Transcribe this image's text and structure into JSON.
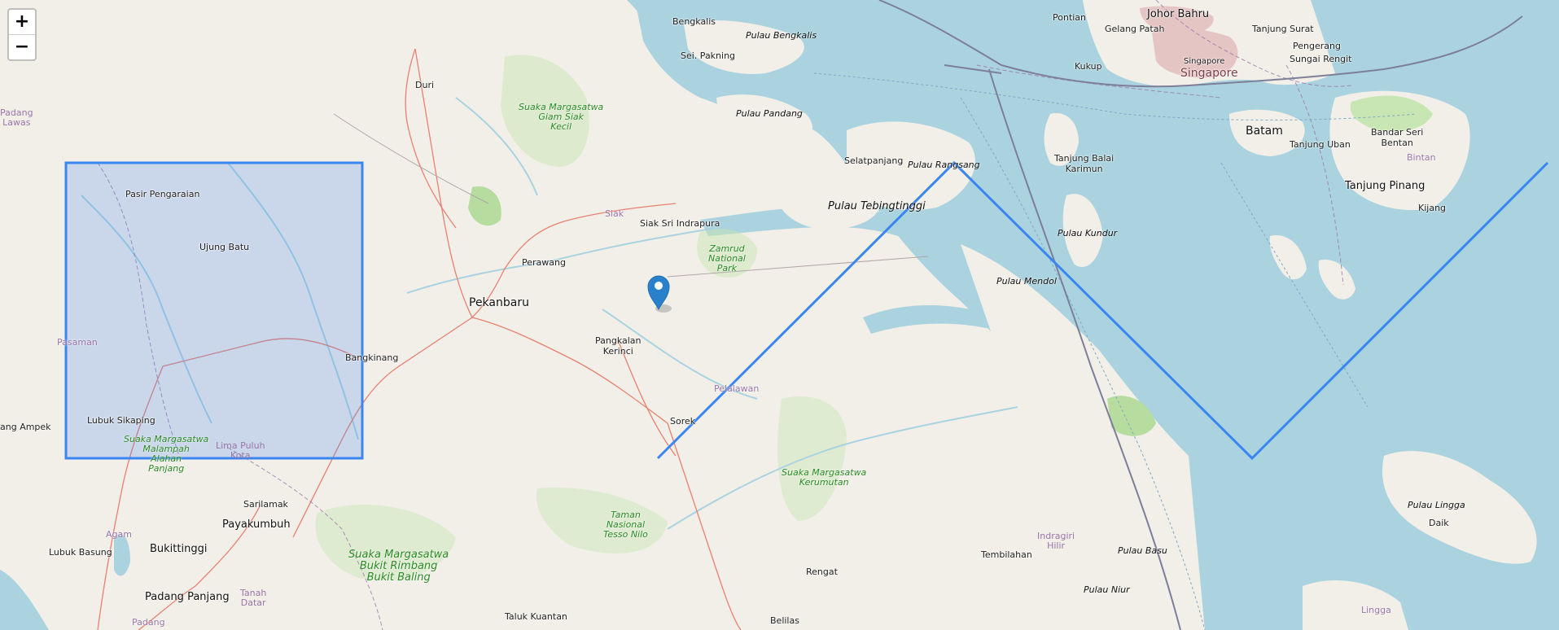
{
  "controls": {
    "zoom_in": "+",
    "zoom_out": "−"
  },
  "places": {
    "bengkalis": "Bengkalis",
    "pulau_bengkalis": "Pulau Bengkalis",
    "sei_pakning": "Sei. Pakning",
    "duri": "Duri",
    "pulau_pandang": "Pulau Pandang",
    "selatpanjang": "Selatpanjang",
    "pulau_rangsang": "Pulau Rangsang",
    "pulau_tebingtinggi": "Pulau Tebingtinggi",
    "siak": "Siak",
    "siak_sri_indrapura": "Siak Sri Indrapura",
    "perawang": "Perawang",
    "pekanbaru": "Pekanbaru",
    "pasir_pengaraian": "Pasir Pengaraian",
    "ujung_batu": "Ujung Batu",
    "bangkinang": "Bangkinang",
    "pasaman": "Pasaman",
    "padang_lawas": "Padang\nLawas",
    "lubuk_sikaping": "Lubuk Sikaping",
    "pangkalan_kerinci": "Pangkalan\nKerinci",
    "pelalawan": "Pelalawan",
    "sorek": "Sorek",
    "pulau_mendol": "Pulau Mendol",
    "pulau_kundur": "Pulau Kundur",
    "tanjung_balai_karimun": "Tanjung Balai\nKarimun",
    "pontian": "Pontian",
    "gelang_patah": "Gelang Patah",
    "johor_bahru": "Johor Bahru",
    "tanjung_surat": "Tanjung Surat",
    "pengerang": "Pengerang",
    "sungai_rengit": "Sungai Rengit",
    "kukup": "Kukup",
    "singapore_small": "Singapore",
    "singapore": "Singapore",
    "batam": "Batam",
    "tanjung_uban": "Tanjung Uban",
    "bandar_seri_bentan": "Bandar Seri\nBentan",
    "bintan": "Bintan",
    "tanjung_pinang": "Tanjung Pinang",
    "kijang": "Kijang",
    "sarilamak": "Sarilamak",
    "payakumbuh": "Payakumbuh",
    "lubuk_basung": "Lubuk Basung",
    "bukittinggi": "Bukittinggi",
    "padang_panjang": "Padang Panjang",
    "agam": "Agam",
    "tanah_datar": "Tanah\nDatar",
    "padang": "Padang",
    "lima_puluh_kota": "Lima Puluh\nKota",
    "padang_ampek": "ang Ampek",
    "tembilahan": "Tembilahan",
    "indragiri_hilir": "Indragiri\nHilir",
    "pulau_basu": "Pulau Basu",
    "pulau_niur": "Pulau Niur",
    "rengat": "Rengat",
    "belilas": "Belilas",
    "taluk_kuantan": "Taluk Kuantan",
    "pulau_lingga": "Pulau Lingga",
    "daik": "Daik",
    "lingga": "Lingga",
    "sm_giam_siak_kecil": "Suaka Margasatwa\nGiam Siak\nKecil",
    "zamrud_np": "Zamrud\nNational\nPark",
    "sm_kerumutan": "Suaka Margasatwa\nKerumutan",
    "tn_tesso_nilo": "Taman\nNasional\nTesso Nilo",
    "sm_bukit_rimbang": "Suaka Margasatwa\nBukit Rimbang\nBukit Baling",
    "sm_malampah": "Suaka Margasatwa\nMalampah\nAlahan\nPanjang"
  },
  "overlay": {
    "rectangle_color": "#3a86f0",
    "polyline_color": "#3a86f0",
    "marker_color": "#2a81cb"
  },
  "colors": {
    "land": "#f2efe9",
    "water": "#aad3df",
    "park": "#c8e6b3",
    "road": "#e8806f",
    "river": "#aad3df",
    "boundary": "#9b76a8"
  }
}
